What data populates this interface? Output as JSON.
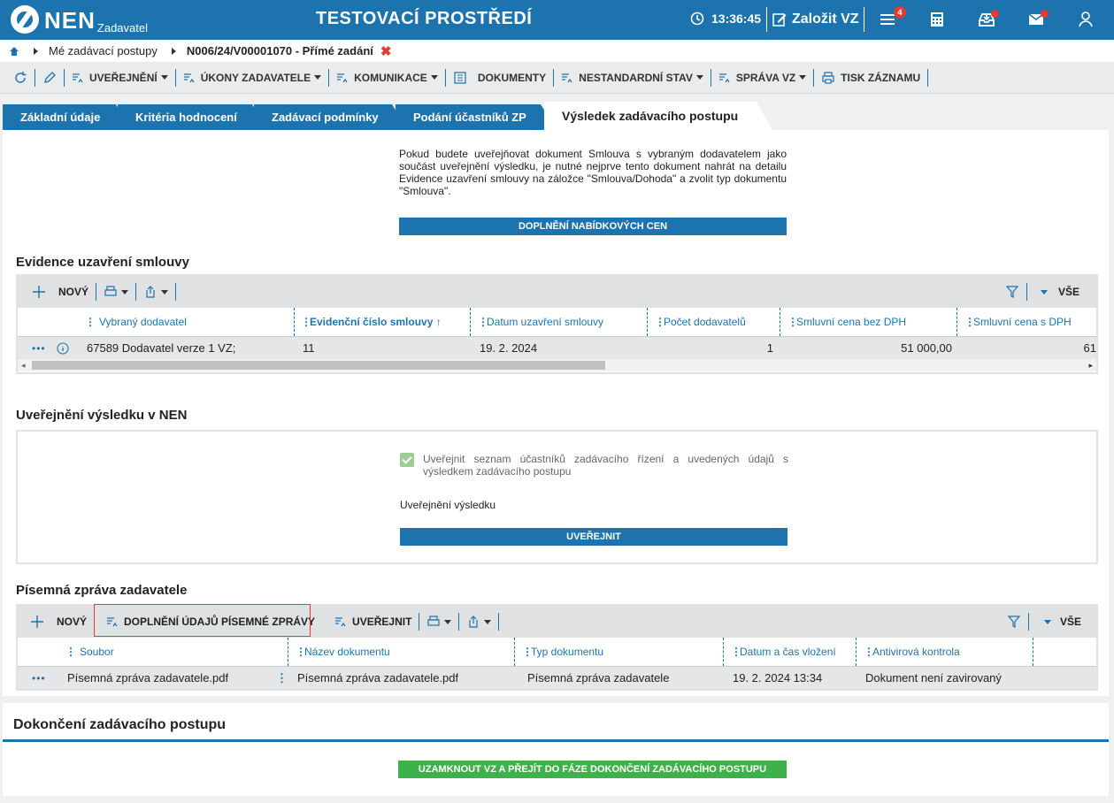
{
  "app": {
    "logo_text": "NEN",
    "logo_sub": "Zadavatel",
    "env_title": "TESTOVACÍ PROSTŘEDÍ",
    "clock": "13:36:45",
    "create_vz": "Založit VZ",
    "notif_count": "4"
  },
  "breadcrumb": {
    "item1": "Mé zadávací postupy",
    "item2": "N006/24/V00001070 - Přímé zadání",
    "close": "✖"
  },
  "toolbar": {
    "publish": "UVEŘEJNĚNÍ",
    "actions": "ÚKONY ZADAVATELE",
    "communication": "KOMUNIKACE",
    "documents": "DOKUMENTY",
    "nonstandard": "NESTANDARDNÍ STAV",
    "management": "SPRÁVA VZ",
    "print": "TISK ZÁZNAMU"
  },
  "tabs": [
    {
      "label": "Základní údaje"
    },
    {
      "label": "Kritéria hodnocení"
    },
    {
      "label": "Zadávací podmínky"
    },
    {
      "label": "Podání účastníků ZP"
    },
    {
      "label": "Výsledek zadávacího postupu"
    }
  ],
  "info": {
    "text": "Pokud budete uveřejňovat dokument Smlouva s vybraným dodavatelem jako součást uveřejnění výsledku, je nutné nejprve tento dokument nahrát na detailu Evidence uzavření smlouvy na záložce \"Smlouva/Dohoda\" a zvolit typ dokumentu \"Smlouva\".",
    "button": "DOPLNĚNÍ NABÍDKOVÝCH CEN"
  },
  "contracts": {
    "title": "Evidence uzavření smlouvy",
    "new_label": "NOVÝ",
    "all_label": "VŠE",
    "columns": [
      "Vybraný dodavatel",
      "Evidenční číslo smlouvy",
      "Datum uzavření smlouvy",
      "Počet dodavatelů",
      "Smluvní cena bez DPH",
      "Smluvní cena s DPH"
    ],
    "sort_arrow": "↑",
    "row": {
      "supplier": "67589 Dodavatel verze 1 VZ;",
      "number": "11",
      "date": "19. 2. 2024",
      "count": "1",
      "price_net": "51 000,00",
      "price_gross": "61"
    }
  },
  "publication": {
    "title": "Uveřejnění výsledku v NEN",
    "checkbox_label": "Uveřejnit seznam účastníků zadávacího řízení a uvedených údajů s výsledkem zadávacího postupu",
    "result_label": "Uveřejnění výsledku",
    "button": "UVEŘEJNIT"
  },
  "report": {
    "title": "Písemná zpráva zadavatele",
    "new_label": "NOVÝ",
    "complete_label": "DOPLNĚNÍ ÚDAJŮ PÍSEMNÉ ZPRÁVY",
    "publish_label": "UVEŘEJNIT",
    "all_label": "VŠE",
    "columns": [
      "Soubor",
      "Název dokumentu",
      "Typ dokumentu",
      "Datum a čas vložení",
      "Antivirová kontrola"
    ],
    "row": {
      "file": "Písemná zpráva zadavatele.pdf",
      "name": "Písemná zpráva zadavatele.pdf",
      "type": "Písemná zpráva zadavatele",
      "datetime": "19. 2. 2024 13:34",
      "antivirus": "Dokument není zavirovaný"
    }
  },
  "completion": {
    "title": "Dokončení zadávacího postupu",
    "button": "UZAMKNOUT VZ A PŘEJÍT DO FÁZE DOKONČENÍ ZADÁVACÍHO POSTUPU"
  },
  "colors": {
    "primary": "#1d73ad",
    "success": "#3fb14a",
    "alert": "#e03c31"
  }
}
